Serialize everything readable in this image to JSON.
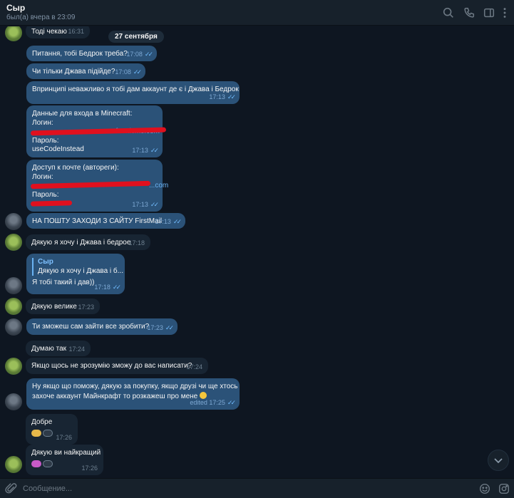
{
  "header": {
    "name": "Сыр",
    "status": "был(а) вчера в 23:09"
  },
  "date_divider": "27 сентября",
  "messages": [
    {
      "text": "Тоді чекаю",
      "time": "16:31"
    },
    {
      "text": "Питання, тобі Бедрок треба?",
      "time": "17:08"
    },
    {
      "text": "Чи тільки Джава підійде?",
      "time": "17:08"
    },
    {
      "text": "Впринципі неважливо я тобі дам аккаунт де є і Джава і Бедрок",
      "time": "17:13"
    },
    {
      "lines": [
        "Данные для входа в Minecraft:",
        "Логин:",
        "...craftomicms.com",
        "Пароль:",
        "useCodeInstead"
      ],
      "time": "17:13"
    },
    {
      "lines": [
        "Доступ к почте (автореги):",
        "Логин:",
        "...com",
        "Пароль:"
      ],
      "time": "17:13"
    },
    {
      "text": "НА ПОШТУ ЗАХОДИ З САЙТУ FirstMail",
      "time": "17:13"
    },
    {
      "text": "Дякую я хочу і Джава і бедрое",
      "time": "17:18"
    },
    {
      "reply_name": "Сыр",
      "reply_text": "Дякую я хочу і Джава і б...",
      "text": "Я тобі такий і дав))",
      "time": "17:18"
    },
    {
      "text": "Дякую велике",
      "time": "17:23"
    },
    {
      "text": "Ти зможеш сам зайти все зробити?",
      "time": "17:23"
    },
    {
      "text": "Думаю так",
      "time": "17:24"
    },
    {
      "text": "Якщо щось не зрозумію зможу до вас написати?",
      "time": "17:24"
    },
    {
      "lines": [
        "Ну якщо що поможу, дякую за покупку, якщо друзі чи ще хтось",
        "захоче аккаунт Майнкрафт то розкажеш про мене"
      ],
      "time": "edited 17:25"
    },
    {
      "text": "Добре",
      "time": "17:26"
    },
    {
      "text": "Дякую ви найкращий",
      "time": "17:26"
    }
  ],
  "composer": {
    "placeholder": "Сообщение..."
  },
  "icons": {
    "search": "search-icon",
    "call": "phone-icon",
    "sidebar": "sidebar-toggle-icon",
    "more": "more-vertical-icon",
    "attach": "paperclip-icon",
    "emoji": "emoji-icon",
    "sticker": "sticker-icon",
    "scroll": "chevron-down-icon"
  },
  "colors": {
    "background": "#0e1621",
    "incoming": "#182533",
    "outgoing": "#2b5278",
    "accent": "#6ab2f2"
  }
}
